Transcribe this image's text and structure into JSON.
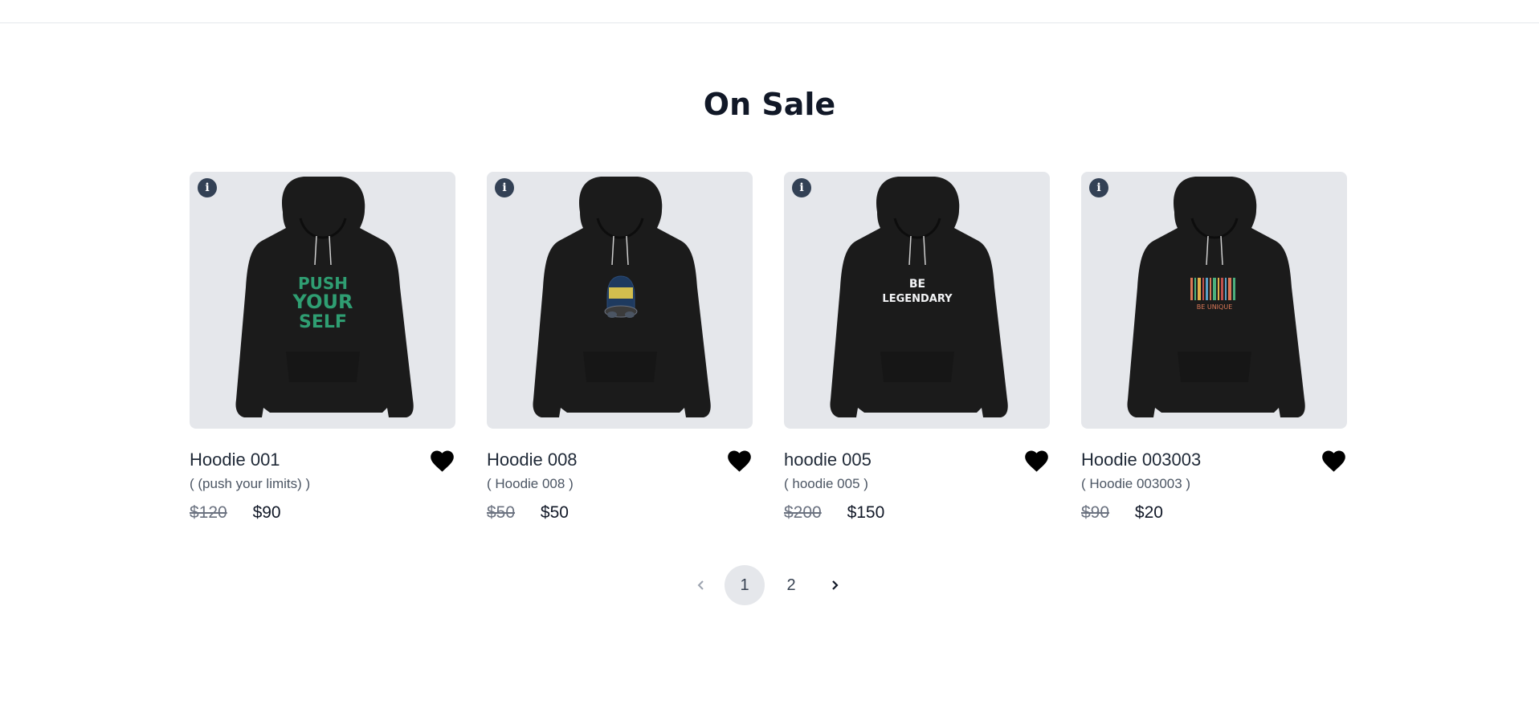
{
  "section": {
    "title": "On Sale"
  },
  "products": [
    {
      "name": "Hoodie 001",
      "subtitle": "( (push your limits) )",
      "old_price": "$120",
      "price": "$90",
      "print": "PUSH YOUR SELF",
      "print_color": "#2f9e72"
    },
    {
      "name": "Hoodie 008",
      "subtitle": "( Hoodie 008 )",
      "old_price": "$50",
      "price": "$50",
      "print": "",
      "print_color": "#1e3a5f"
    },
    {
      "name": "hoodie 005",
      "subtitle": "( hoodie 005 )",
      "old_price": "$200",
      "price": "$150",
      "print": "BE LEGENDARY",
      "print_color": "#f3f4f6"
    },
    {
      "name": "Hoodie 003003",
      "subtitle": "( Hoodie 003003 )",
      "old_price": "$90",
      "price": "$20",
      "print": "BE UNIQUE",
      "print_color": "#d97757"
    }
  ],
  "pagination": {
    "prev_icon": "chevron-left-icon",
    "pages": [
      "1",
      "2"
    ],
    "current": "1",
    "next_icon": "chevron-right-icon"
  },
  "colors": {
    "card_bg": "#e5e7eb",
    "info_badge": "#334155",
    "heart": "#000000"
  }
}
